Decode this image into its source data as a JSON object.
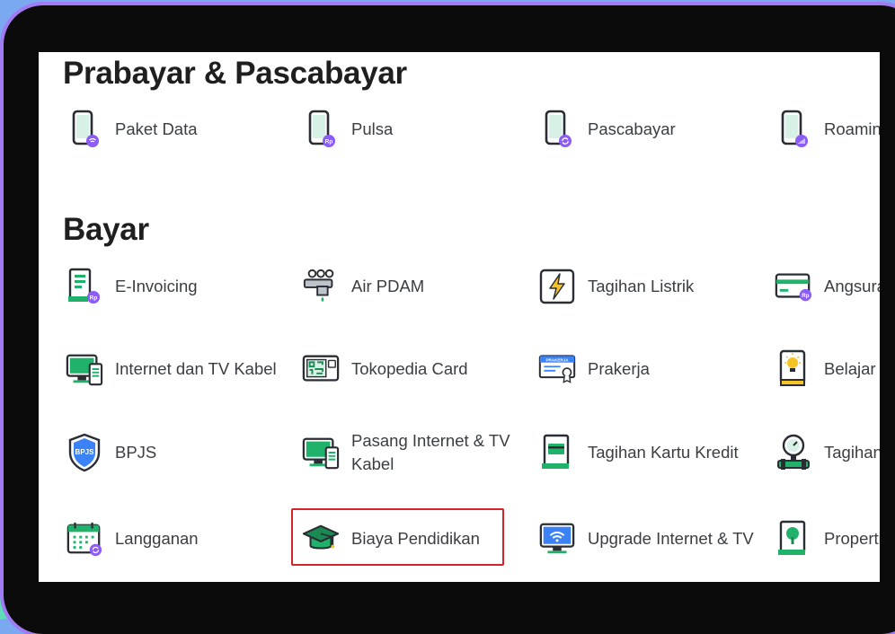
{
  "sections": [
    {
      "title": "Prabayar & Pascabayar",
      "items": [
        {
          "label": "Paket Data",
          "icon": "phone-wifi-icon"
        },
        {
          "label": "Pulsa",
          "icon": "phone-rp-icon"
        },
        {
          "label": "Pascabayar",
          "icon": "phone-refresh-icon"
        },
        {
          "label": "Roaming",
          "icon": "phone-signal-icon"
        }
      ]
    },
    {
      "title": "Bayar",
      "items": [
        {
          "label": "E-Invoicing",
          "icon": "invoice-icon"
        },
        {
          "label": "Air PDAM",
          "icon": "water-tap-icon"
        },
        {
          "label": "Tagihan Listrik",
          "icon": "lightning-icon"
        },
        {
          "label": "Angsuran Kredit",
          "icon": "credit-card-icon"
        },
        {
          "label": "Internet dan TV Kabel",
          "icon": "monitor-phone-icon"
        },
        {
          "label": "Tokopedia Card",
          "icon": "tokopedia-card-icon"
        },
        {
          "label": "Prakerja",
          "icon": "certificate-icon"
        },
        {
          "label": "Belajar",
          "icon": "book-bulb-icon"
        },
        {
          "label": "BPJS",
          "icon": "bpjs-shield-icon"
        },
        {
          "label": "Pasang Internet & TV Kabel",
          "icon": "monitor-install-icon"
        },
        {
          "label": "Tagihan Kartu Kredit",
          "icon": "card-receipt-icon"
        },
        {
          "label": "Tagihan Gas",
          "icon": "gas-meter-icon"
        },
        {
          "label": "Langganan",
          "icon": "calendar-icon"
        },
        {
          "label": "Biaya Pendidikan",
          "icon": "graduation-cap-icon"
        },
        {
          "label": "Upgrade Internet & TV",
          "icon": "monitor-wifi-icon"
        },
        {
          "label": "Properti",
          "icon": "property-tree-icon"
        }
      ]
    }
  ],
  "highlighted_item": "Biaya Pendidikan",
  "colors": {
    "green": "#20b26a",
    "dark_green": "#1a8a52",
    "purple": "#8b5cf6",
    "highlight_red": "#d4242b",
    "device_frame": "#0b0b0b",
    "device_outline": "#a07bf2"
  }
}
